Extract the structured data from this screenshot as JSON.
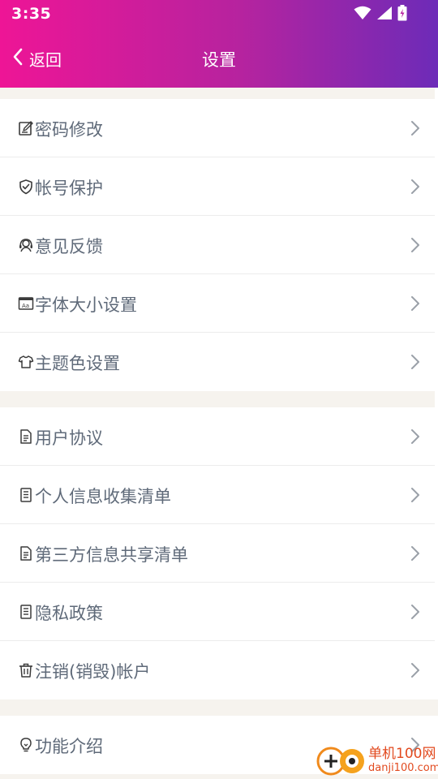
{
  "status": {
    "time": "3:35"
  },
  "nav": {
    "back_label": "返回",
    "title": "设置"
  },
  "groups": [
    [
      {
        "label": "密码修改",
        "icon": "edit-icon"
      },
      {
        "label": "帐号保护",
        "icon": "shield-icon"
      },
      {
        "label": "意见反馈",
        "icon": "headset-icon"
      },
      {
        "label": "字体大小设置",
        "icon": "font-size-icon"
      },
      {
        "label": "主题色设置",
        "icon": "tshirt-icon"
      }
    ],
    [
      {
        "label": "用户协议",
        "icon": "document-icon"
      },
      {
        "label": "个人信息收集清单",
        "icon": "list-document-icon"
      },
      {
        "label": "第三方信息共享清单",
        "icon": "document-icon"
      },
      {
        "label": "隐私政策",
        "icon": "list-document-icon"
      },
      {
        "label": "注销(销毁)帐户",
        "icon": "trash-icon"
      }
    ],
    [
      {
        "label": "功能介绍",
        "icon": "lightbulb-icon"
      }
    ]
  ],
  "watermark": {
    "name": "单机100网",
    "url": "danji100.com"
  },
  "colors": {
    "header_start": "#ee1596",
    "header_end": "#6d2bb8",
    "label": "#5f6a79",
    "background": "#f6f3ee"
  }
}
